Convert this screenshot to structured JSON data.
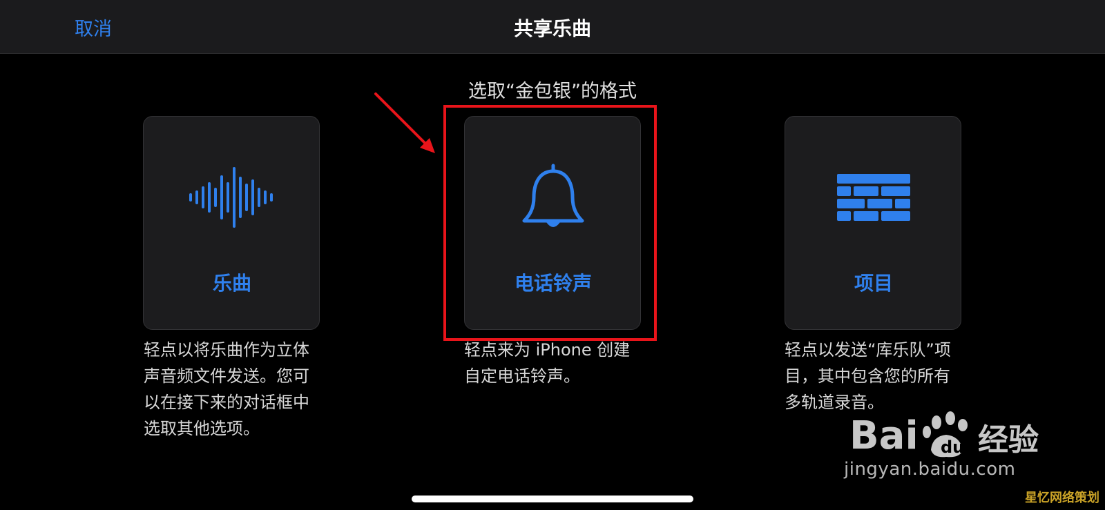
{
  "nav": {
    "cancel_label": "取消",
    "title": "共享乐曲"
  },
  "subtitle": "选取“金包银”的格式",
  "options": [
    {
      "label": "乐曲",
      "icon": "waveform-icon",
      "description": "轻点以将乐曲作为立体声音频文件发送。您可以在接下来的对话框中选取其他选项。"
    },
    {
      "label": "电话铃声",
      "icon": "bell-icon",
      "description": "轻点来为 iPhone 创建自定电话铃声。"
    },
    {
      "label": "项目",
      "icon": "bricks-icon",
      "description": "轻点以发送“库乐队”项目，其中包含您的所有多轨道录音。"
    }
  ],
  "annotation": {
    "highlight_color": "#e8141a",
    "highlighted_option": "电话铃声"
  },
  "watermark": {
    "url": "jingyan.baidu.com",
    "corner_text": "星忆网络策划"
  },
  "colors": {
    "accent": "#2f80ed",
    "background": "#000000",
    "card": "#1c1c1e",
    "nav": "#1b1b1d"
  }
}
